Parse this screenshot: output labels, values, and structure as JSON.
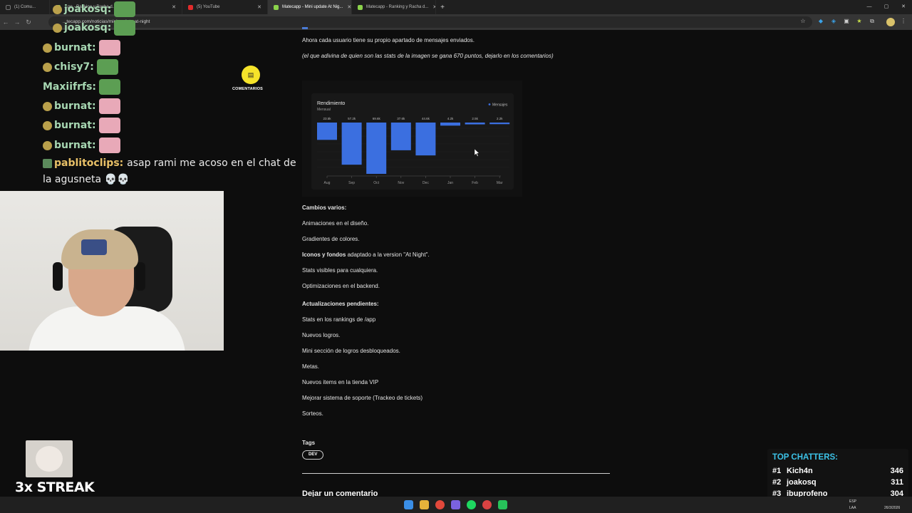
{
  "browser": {
    "tabs": [
      {
        "label": "(1) Comu...",
        "icon": "x-logo-icon",
        "color": "#222222"
      },
      {
        "label": "...pp - Ranking y Racha d...",
        "icon": "matecapp-icon",
        "color": "#8bd34b"
      },
      {
        "label": "(5) YouTube",
        "icon": "youtube-icon",
        "color": "#e22b2b"
      },
      {
        "label": "Matecapp - Mini update At Nig...",
        "icon": "matecapp-icon",
        "color": "#8bd34b",
        "active": true
      },
      {
        "label": "Matecapp - Ranking y Racha d...",
        "icon": "matecapp-icon",
        "color": "#8bd34b"
      }
    ],
    "url": "...tecapp.com/noticias/mini-update-at-night"
  },
  "chat": {
    "lines": [
      {
        "user": "joakosq:",
        "emote": "frog"
      },
      {
        "user": "joakosq:",
        "emote": "frog"
      },
      {
        "user": "burnat:",
        "emote": "pink"
      },
      {
        "user": "chisy7:",
        "emote": "frog"
      },
      {
        "user": "Maxiifrfs:",
        "emote": "frog"
      },
      {
        "user": "burnat:",
        "emote": "pink"
      },
      {
        "user": "burnat:",
        "emote": "pink"
      },
      {
        "user": "burnat:",
        "emote": "pink"
      }
    ],
    "pablito": {
      "user": "pablitoclips:",
      "msg1": "asap rami me acoso en el chat de",
      "msg2": "la agusneta 💀💀"
    }
  },
  "comments_button": {
    "label": "COMENTARIOS"
  },
  "streak": {
    "label": "3x STREAK"
  },
  "article": {
    "p1": "Ahora cada usuario tiene su propio apartado de mensajes enviados.",
    "p2": "(el que adivina de quien son las stats de la imagen se gana 670 puntos, dejarlo en los comentarios)",
    "cambios_title": "Cambios varios:",
    "cambios": [
      "Animaciones en el diseño.",
      "Gradientes de colores."
    ],
    "iconos_bold": "Iconos y fondos",
    "iconos_rest": " adaptado a la version \"At Night\".",
    "cambios2": [
      "Stats visibles para cualquiera.",
      "Optimizaciones en el backend."
    ],
    "pendientes_title": "Actualizaciones pendientes:",
    "pendientes": [
      "Stats en los rankings de /app",
      "Nuevos logros.",
      "Mini sección de logros desbloqueados.",
      "Metas.",
      "Nuevos items en la tienda VIP",
      "Mejorar sistema de soporte (Trackeo de tickets)",
      "Sorteos."
    ],
    "tags_title": "Tags",
    "tag": "DEV",
    "comment_heading": "Dejar un comentario"
  },
  "chart_data": {
    "type": "bar",
    "title": "Rendimiento",
    "subtitle": "Mensual",
    "legend": "Mensajes",
    "categories": [
      "Aug",
      "Sep",
      "Oct",
      "Nov",
      "Dec",
      "Jan",
      "Feb",
      "Mar"
    ],
    "values": [
      23.5,
      57.2,
      69.6,
      37.6,
      44.6,
      4.2,
      2.5,
      2.2
    ],
    "labels": [
      "23.5k",
      "57.2k",
      "69.6k",
      "37.6k",
      "44.6k",
      "4.2k",
      "2.5k",
      "2.2k"
    ],
    "bar_color": "#3b6fe0"
  },
  "top_chatters": {
    "title": "TOP CHATTERS:",
    "rows": [
      {
        "rank": "#1",
        "name": "Kich4n",
        "count": "346"
      },
      {
        "rank": "#2",
        "name": "joakosq",
        "count": "311"
      },
      {
        "rank": "#3",
        "name": "ibuprofeno",
        "count": "304"
      }
    ]
  },
  "taskbar": {
    "lang": "ESP",
    "lang2": "LAA",
    "date": "26/3/2026"
  }
}
